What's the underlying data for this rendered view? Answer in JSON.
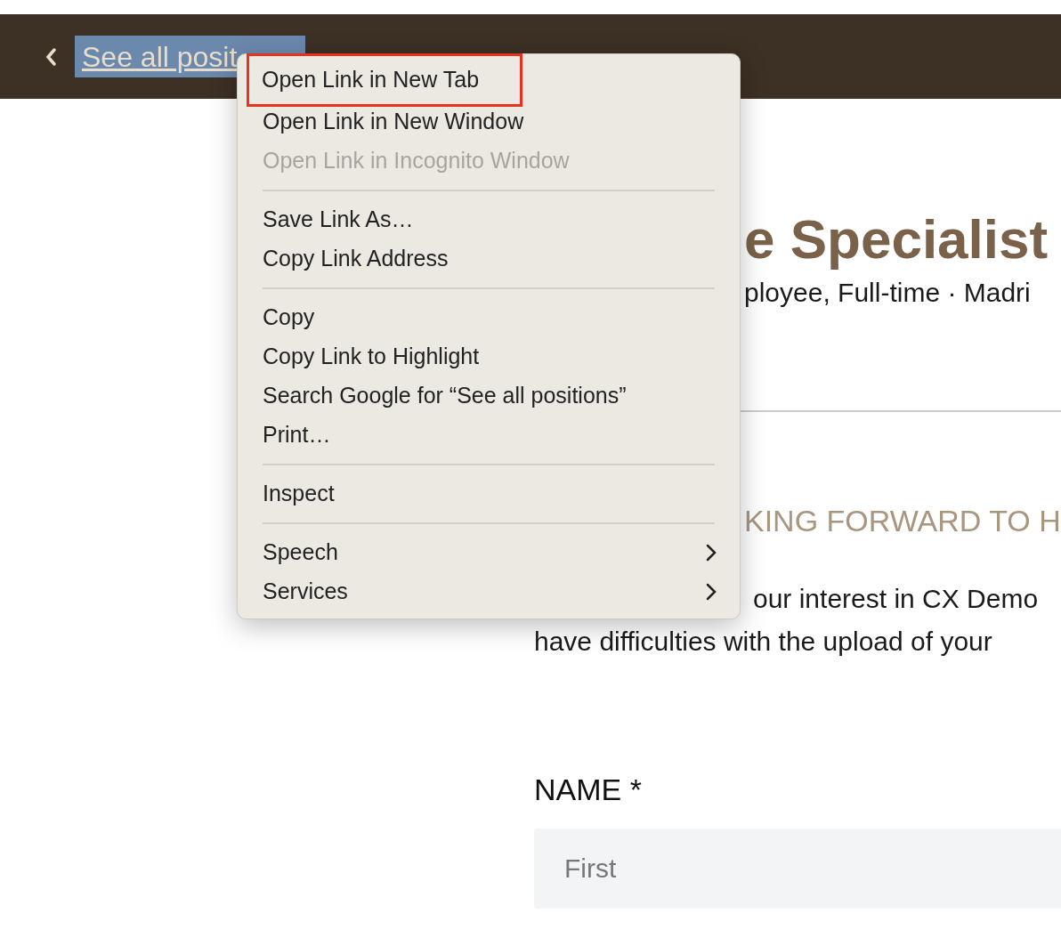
{
  "header": {
    "back_link": {
      "text": "See all posit",
      "selected": true
    }
  },
  "job": {
    "title": "e Specialist",
    "meta": "ployee, Full-time · Madri"
  },
  "section": {
    "heading": "KING FORWARD TO H",
    "intro_lines": [
      "our interest in CX Demo",
      "have difficulties with the upload of your"
    ]
  },
  "form": {
    "name_label": "NAME *",
    "first_field": {
      "placeholder": "First"
    }
  },
  "context_menu": {
    "groups": [
      [
        {
          "label": "Open Link in New Tab",
          "disabled": false,
          "outlined": true,
          "submenu": false
        },
        {
          "label": "Open Link in New Window",
          "disabled": false,
          "outlined": false,
          "submenu": false
        },
        {
          "label": "Open Link in Incognito Window",
          "disabled": true,
          "outlined": false,
          "submenu": false
        }
      ],
      [
        {
          "label": "Save Link As…",
          "disabled": false,
          "outlined": false,
          "submenu": false
        },
        {
          "label": "Copy Link Address",
          "disabled": false,
          "outlined": false,
          "submenu": false
        }
      ],
      [
        {
          "label": "Copy",
          "disabled": false,
          "outlined": false,
          "submenu": false
        },
        {
          "label": "Copy Link to Highlight",
          "disabled": false,
          "outlined": false,
          "submenu": false
        },
        {
          "label": "Search Google for “See all positions”",
          "disabled": false,
          "outlined": false,
          "submenu": false
        },
        {
          "label": "Print…",
          "disabled": false,
          "outlined": false,
          "submenu": false
        }
      ],
      [
        {
          "label": "Inspect",
          "disabled": false,
          "outlined": false,
          "submenu": false
        }
      ],
      [
        {
          "label": "Speech",
          "disabled": false,
          "outlined": false,
          "submenu": true
        },
        {
          "label": "Services",
          "disabled": false,
          "outlined": false,
          "submenu": true
        }
      ]
    ]
  }
}
